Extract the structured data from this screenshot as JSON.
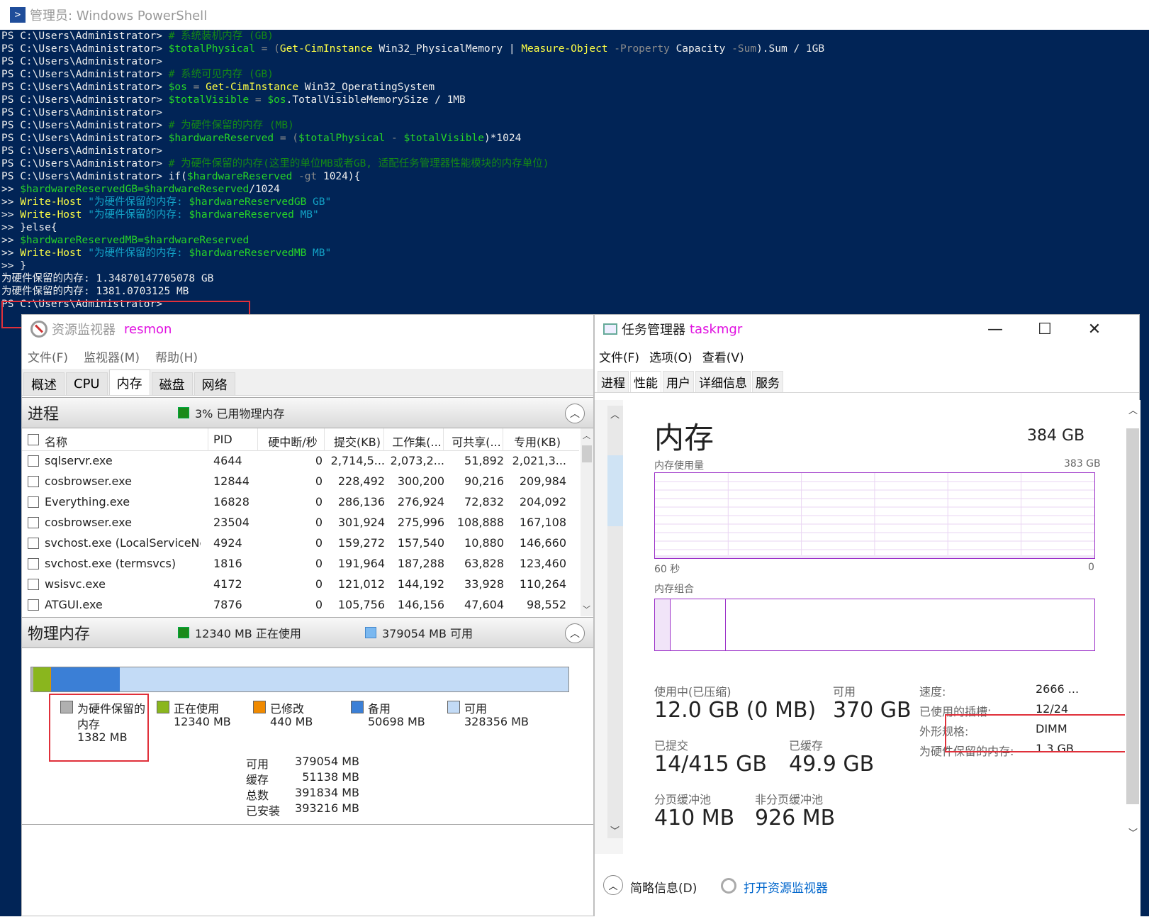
{
  "powershell": {
    "title": "管理员: Windows PowerShell",
    "lines": [
      [
        [
          "PS C:\\Users\\Administrator> ",
          "prompt"
        ],
        [
          "# 系统装机内存 (GB)",
          "cmt"
        ]
      ],
      [
        [
          "PS C:\\Users\\Administrator> ",
          "prompt"
        ],
        [
          "$totalPhysical",
          "var"
        ],
        [
          " = (",
          "op"
        ],
        [
          "Get-CimInstance",
          "cmd"
        ],
        [
          " Win32_PhysicalMemory | ",
          "txt"
        ],
        [
          "Measure-Object",
          "cmd"
        ],
        [
          " -Property",
          "op"
        ],
        [
          " Capacity ",
          "txt"
        ],
        [
          "-Sum",
          "op"
        ],
        [
          ").Sum / 1GB",
          "txt"
        ]
      ],
      [
        [
          "PS C:\\Users\\Administrator>",
          "prompt"
        ]
      ],
      [
        [
          "PS C:\\Users\\Administrator> ",
          "prompt"
        ],
        [
          "# 系统可见内存 (GB)",
          "cmt"
        ]
      ],
      [
        [
          "PS C:\\Users\\Administrator> ",
          "prompt"
        ],
        [
          "$os",
          "var"
        ],
        [
          " = ",
          "op"
        ],
        [
          "Get-CimInstance",
          "cmd"
        ],
        [
          " Win32_OperatingSystem",
          "txt"
        ]
      ],
      [
        [
          "PS C:\\Users\\Administrator> ",
          "prompt"
        ],
        [
          "$totalVisible",
          "var"
        ],
        [
          " = ",
          "op"
        ],
        [
          "$os",
          "var"
        ],
        [
          ".TotalVisibleMemorySize / 1MB",
          "txt"
        ]
      ],
      [
        [
          "PS C:\\Users\\Administrator>",
          "prompt"
        ]
      ],
      [
        [
          "PS C:\\Users\\Administrator> ",
          "prompt"
        ],
        [
          "# 为硬件保留的内存 (MB)",
          "cmt"
        ]
      ],
      [
        [
          "PS C:\\Users\\Administrator> ",
          "prompt"
        ],
        [
          "$hardwareReserved",
          "var"
        ],
        [
          " = (",
          "op"
        ],
        [
          "$totalPhysical",
          "var"
        ],
        [
          " - ",
          "op"
        ],
        [
          "$totalVisible",
          "var"
        ],
        [
          ")*1024",
          "txt"
        ]
      ],
      [
        [
          "PS C:\\Users\\Administrator>",
          "prompt"
        ]
      ],
      [
        [
          "PS C:\\Users\\Administrator> ",
          "prompt"
        ],
        [
          "# 为硬件保留的内存(这里的单位MB或者GB, 适配任务管理器性能模块的内存单位)",
          "cmt"
        ]
      ],
      [
        [
          "PS C:\\Users\\Administrator> ",
          "prompt"
        ],
        [
          "if(",
          "txt"
        ],
        [
          "$hardwareReserved",
          "var"
        ],
        [
          " -gt",
          "op"
        ],
        [
          " 1024){",
          "txt"
        ]
      ],
      [
        [
          ">> ",
          "prompt"
        ],
        [
          "$hardwareReservedGB=$hardwareReserved",
          "var"
        ],
        [
          "/1024",
          "txt"
        ]
      ],
      [
        [
          ">> ",
          "prompt"
        ],
        [
          "Write-Host",
          "cmd"
        ],
        [
          " \"为硬件保留的内存: ",
          "str"
        ],
        [
          "$hardwareReservedGB",
          "var"
        ],
        [
          " GB\"",
          "str"
        ]
      ],
      [
        [
          ">> ",
          "prompt"
        ],
        [
          "Write-Host",
          "cmd"
        ],
        [
          " \"为硬件保留的内存: ",
          "str"
        ],
        [
          "$hardwareReserved",
          "var"
        ],
        [
          " MB\"",
          "str"
        ]
      ],
      [
        [
          ">> ",
          "prompt"
        ],
        [
          "}else{",
          "txt"
        ]
      ],
      [
        [
          ">> ",
          "prompt"
        ],
        [
          "$hardwareReservedMB=$hardwareReserved",
          "var"
        ]
      ],
      [
        [
          ">> ",
          "prompt"
        ],
        [
          "Write-Host",
          "cmd"
        ],
        [
          " \"为硬件保留的内存: ",
          "str"
        ],
        [
          "$hardwareReservedMB",
          "var"
        ],
        [
          " MB\"",
          "str"
        ]
      ],
      [
        [
          ">> }",
          "prompt"
        ]
      ],
      [
        [
          "为硬件保留的内存: 1.34870147705078 GB",
          "txt"
        ]
      ],
      [
        [
          "为硬件保留的内存: 1381.0703125 MB",
          "txt"
        ]
      ],
      [
        [
          "PS C:\\Users\\Administrator>",
          "prompt"
        ]
      ]
    ]
  },
  "resmon": {
    "title": "资源监视器",
    "tag": "resmon",
    "menu": [
      "文件(F)",
      "监视器(M)",
      "帮助(H)"
    ],
    "tabs": [
      "概述",
      "CPU",
      "内存",
      "磁盘",
      "网络"
    ],
    "selected_tab": "内存",
    "processes": {
      "title": "进程",
      "usage_label": "3% 已用物理内存",
      "columns": [
        "名称",
        "PID",
        "硬中断/秒",
        "提交(KB)",
        "工作集(...",
        "可共享(...",
        "专用(KB)"
      ],
      "rows": [
        [
          "sqlservr.exe",
          "4644",
          "0",
          "2,714,5...",
          "2,073,2...",
          "51,892",
          "2,021,3..."
        ],
        [
          "cosbrowser.exe",
          "12844",
          "0",
          "228,492",
          "300,200",
          "90,216",
          "209,984"
        ],
        [
          "Everything.exe",
          "16828",
          "0",
          "286,136",
          "276,924",
          "72,832",
          "204,092"
        ],
        [
          "cosbrowser.exe",
          "23504",
          "0",
          "301,924",
          "275,996",
          "108,888",
          "167,108"
        ],
        [
          "svchost.exe (LocalServiceNo...",
          "4924",
          "0",
          "159,272",
          "157,540",
          "10,880",
          "146,660"
        ],
        [
          "svchost.exe (termsvcs)",
          "1816",
          "0",
          "191,964",
          "187,288",
          "63,828",
          "123,460"
        ],
        [
          "wsisvc.exe",
          "4172",
          "0",
          "121,012",
          "144,192",
          "33,928",
          "110,264"
        ],
        [
          "ATGUI.exe",
          "7876",
          "0",
          "105,756",
          "146,156",
          "47,604",
          "98,552"
        ]
      ]
    },
    "physical": {
      "title": "物理内存",
      "in_use_label": "12340 MB 正在使用",
      "available_label": "379054 MB 可用",
      "bar_fractions": {
        "reserved": 0.0035,
        "in_use": 0.0315,
        "modified": 0.0011,
        "standby": 0.1289,
        "free": 0.835
      },
      "legend": [
        {
          "name": "为硬件保留的",
          "name2": "内存",
          "value": "1382 MB",
          "color": "#b0b0b0"
        },
        {
          "name": "正在使用",
          "value": "12340 MB",
          "color": "#8ab61e"
        },
        {
          "name": "已修改",
          "value": "440 MB",
          "color": "#f08a00"
        },
        {
          "name": "备用",
          "value": "50698 MB",
          "color": "#3b7fd6"
        },
        {
          "name": "可用",
          "value": "328356 MB",
          "color": "#c3dbf6"
        }
      ],
      "totals": [
        {
          "label": "可用",
          "value": "379054 MB"
        },
        {
          "label": "缓存",
          "value": "51138 MB"
        },
        {
          "label": "总数",
          "value": "391834 MB"
        },
        {
          "label": "已安装",
          "value": "393216 MB"
        }
      ]
    }
  },
  "taskmgr": {
    "title": "任务管理器",
    "tag": "taskmgr",
    "menu": [
      "文件(F)",
      "选项(O)",
      "查看(V)"
    ],
    "tabs": [
      "进程",
      "性能",
      "用户",
      "详细信息",
      "服务"
    ],
    "selected_tab": "性能",
    "memory": {
      "heading": "内存",
      "total": "384 GB",
      "usage_label": "内存使用量",
      "usage_max": "383 GB",
      "time_left": "60 秒",
      "time_right": "0",
      "composition_label": "内存组合",
      "in_use_label": "使用中(已压缩)",
      "in_use_value": "12.0 GB (0 MB)",
      "available_label": "可用",
      "available_value": "370 GB",
      "committed_label": "已提交",
      "committed_value": "14/415 GB",
      "cached_label": "已缓存",
      "cached_value": "49.9 GB",
      "paged_label": "分页缓冲池",
      "paged_value": "410 MB",
      "nonpaged_label": "非分页缓冲池",
      "nonpaged_value": "926 MB",
      "details": [
        {
          "label": "速度:",
          "value": "2666 ..."
        },
        {
          "label": "已使用的插槽:",
          "value": "12/24"
        },
        {
          "label": "外形规格:",
          "value": "DIMM"
        },
        {
          "label": "为硬件保留的内存:",
          "value": "1.3 GB"
        }
      ]
    },
    "footer": {
      "fewer_details": "简略信息(D)",
      "open_resmon": "打开资源监视器"
    },
    "window_buttons": {
      "minimize": "—",
      "maximize": "☐",
      "close": "✕"
    }
  },
  "colors": {
    "ps_bg": "#012456",
    "highlight_red": "#e0303a",
    "taskmgr_memory_purple": "#9b30c8"
  }
}
